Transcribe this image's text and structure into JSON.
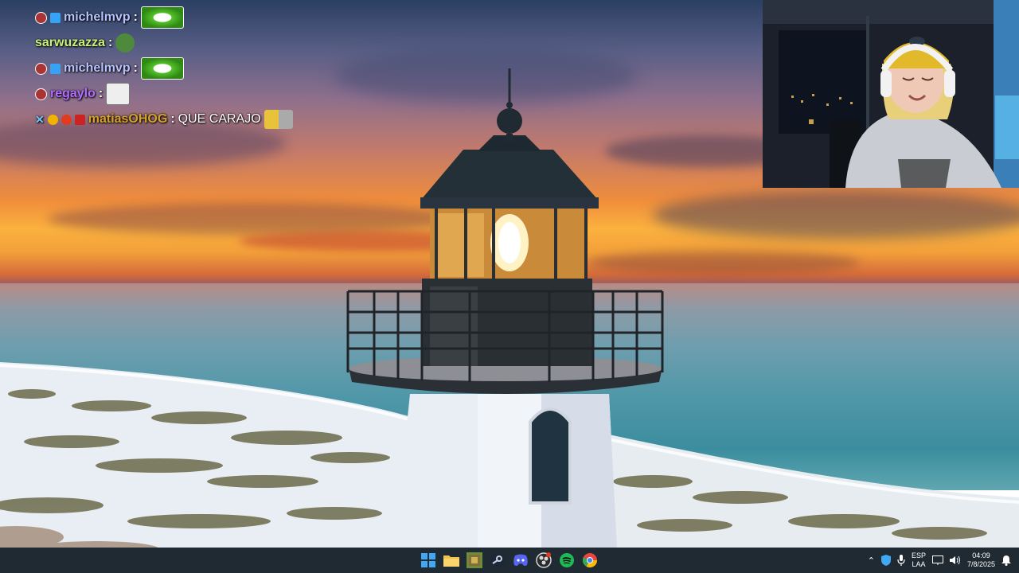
{
  "chat": {
    "messages": [
      {
        "user": "michelmvp",
        "user_color": "#b7c3ff",
        "suffix": ":",
        "text": "",
        "emote": "green-smile-emote"
      },
      {
        "user": "sarwuzazza",
        "user_color": "#c9f27a",
        "suffix": ":",
        "text": "",
        "emote": "pepe-emote"
      },
      {
        "user": "michelmvp",
        "user_color": "#b7c3ff",
        "suffix": ":",
        "text": "",
        "emote": "green-smile-emote"
      },
      {
        "user": "regaylo",
        "user_color": "#b26cff",
        "suffix": ":",
        "text": "",
        "emote": "paper-cat-emote"
      },
      {
        "user": "matiasOHOG",
        "user_color": "#d6a22a",
        "suffix": ":",
        "text": "QUE CARAJO",
        "emote": "yellow-cat-emote"
      }
    ]
  },
  "webcam": {
    "label": "streamer-webcam"
  },
  "taskbar": {
    "apps": [
      {
        "name": "windows-start",
        "color": "#3fa9f5"
      },
      {
        "name": "file-explorer",
        "color": "#f2c14e"
      },
      {
        "name": "minecraft-launcher",
        "color": "#6b8e3a"
      },
      {
        "name": "steam",
        "color": "#c7d5e0"
      },
      {
        "name": "discord",
        "color": "#5865f2"
      },
      {
        "name": "obs",
        "color": "#d8d8d8"
      },
      {
        "name": "spotify",
        "color": "#1db954"
      },
      {
        "name": "chrome",
        "color": "#e8453c"
      }
    ],
    "language_top": "ESP",
    "language_bottom": "LAA",
    "time": "04:09",
    "date": "7/8/2025"
  }
}
